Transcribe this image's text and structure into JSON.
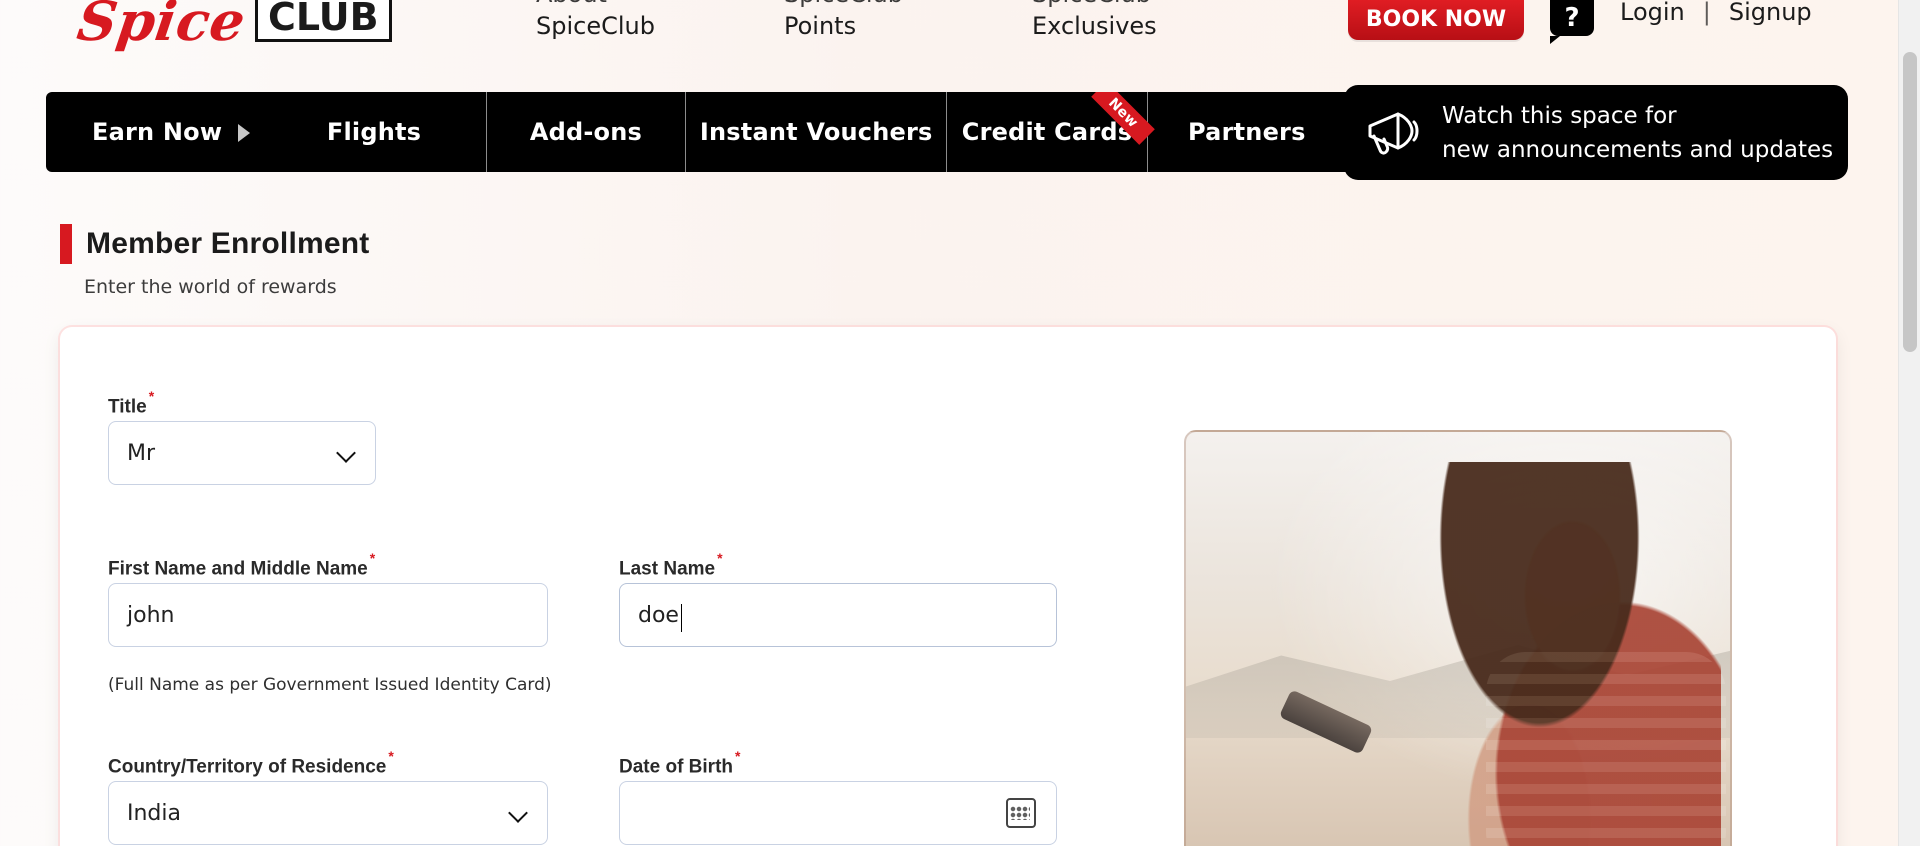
{
  "header": {
    "brand_left": "Spice",
    "brand_right": "CLUB",
    "top_nav": [
      {
        "cut": "About",
        "main": "SpiceClub"
      },
      {
        "cut": "SpiceClub",
        "main": "Points"
      },
      {
        "cut": "SpiceClub",
        "main": "Exclusives"
      }
    ],
    "book_now": "BOOK NOW",
    "help": "?",
    "login": "Login",
    "separator": "|",
    "signup": "Signup"
  },
  "main_nav": {
    "items": [
      "Earn Now",
      "Flights",
      "Add-ons",
      "Instant Vouchers",
      "Credit Cards",
      "Partners"
    ],
    "new_badge": "New",
    "announcement_line1": "Watch this space for",
    "announcement_line2": "new announcements and updates"
  },
  "page": {
    "title": "Member Enrollment",
    "subtitle": "Enter the world of rewards"
  },
  "form": {
    "title_label": "Title",
    "title_value": "Mr",
    "first_name_label": "First Name and Middle Name",
    "first_name_value": "john",
    "last_name_label": "Last Name",
    "last_name_value": "doe",
    "name_help": "(Full Name as per Government Issued Identity Card)",
    "country_label": "Country/Territory of Residence",
    "country_value": "India",
    "dob_label": "Date of Birth",
    "dob_value": ""
  }
}
